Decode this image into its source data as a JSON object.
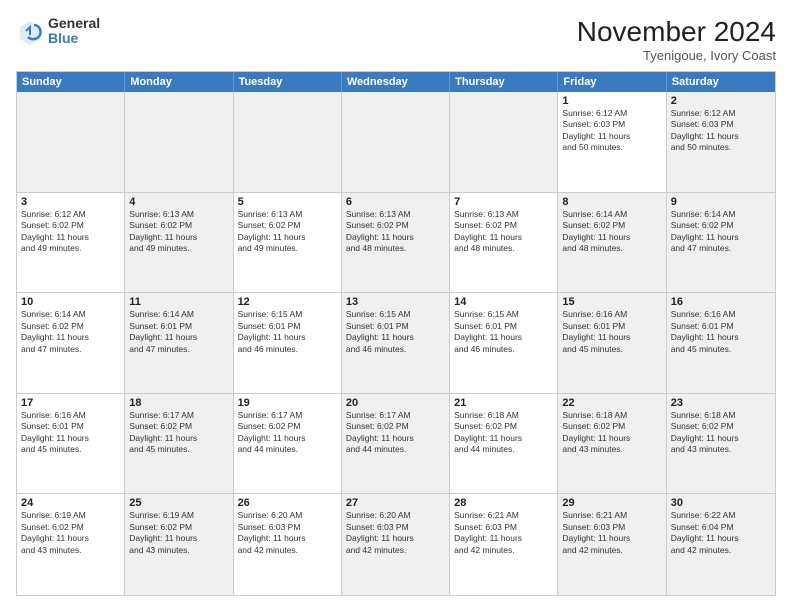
{
  "logo": {
    "general": "General",
    "blue": "Blue"
  },
  "title": "November 2024",
  "location": "Tyenigoue, Ivory Coast",
  "days_of_week": [
    "Sunday",
    "Monday",
    "Tuesday",
    "Wednesday",
    "Thursday",
    "Friday",
    "Saturday"
  ],
  "weeks": [
    [
      {
        "day": "",
        "info": "",
        "shaded": true
      },
      {
        "day": "",
        "info": "",
        "shaded": true
      },
      {
        "day": "",
        "info": "",
        "shaded": true
      },
      {
        "day": "",
        "info": "",
        "shaded": true
      },
      {
        "day": "",
        "info": "",
        "shaded": true
      },
      {
        "day": "1",
        "info": "Sunrise: 6:12 AM\nSunset: 6:03 PM\nDaylight: 11 hours\nand 50 minutes.",
        "shaded": false
      },
      {
        "day": "2",
        "info": "Sunrise: 6:12 AM\nSunset: 6:03 PM\nDaylight: 11 hours\nand 50 minutes.",
        "shaded": true
      }
    ],
    [
      {
        "day": "3",
        "info": "Sunrise: 6:12 AM\nSunset: 6:02 PM\nDaylight: 11 hours\nand 49 minutes.",
        "shaded": false
      },
      {
        "day": "4",
        "info": "Sunrise: 6:13 AM\nSunset: 6:02 PM\nDaylight: 11 hours\nand 49 minutes.",
        "shaded": true
      },
      {
        "day": "5",
        "info": "Sunrise: 6:13 AM\nSunset: 6:02 PM\nDaylight: 11 hours\nand 49 minutes.",
        "shaded": false
      },
      {
        "day": "6",
        "info": "Sunrise: 6:13 AM\nSunset: 6:02 PM\nDaylight: 11 hours\nand 48 minutes.",
        "shaded": true
      },
      {
        "day": "7",
        "info": "Sunrise: 6:13 AM\nSunset: 6:02 PM\nDaylight: 11 hours\nand 48 minutes.",
        "shaded": false
      },
      {
        "day": "8",
        "info": "Sunrise: 6:14 AM\nSunset: 6:02 PM\nDaylight: 11 hours\nand 48 minutes.",
        "shaded": true
      },
      {
        "day": "9",
        "info": "Sunrise: 6:14 AM\nSunset: 6:02 PM\nDaylight: 11 hours\nand 47 minutes.",
        "shaded": true
      }
    ],
    [
      {
        "day": "10",
        "info": "Sunrise: 6:14 AM\nSunset: 6:02 PM\nDaylight: 11 hours\nand 47 minutes.",
        "shaded": false
      },
      {
        "day": "11",
        "info": "Sunrise: 6:14 AM\nSunset: 6:01 PM\nDaylight: 11 hours\nand 47 minutes.",
        "shaded": true
      },
      {
        "day": "12",
        "info": "Sunrise: 6:15 AM\nSunset: 6:01 PM\nDaylight: 11 hours\nand 46 minutes.",
        "shaded": false
      },
      {
        "day": "13",
        "info": "Sunrise: 6:15 AM\nSunset: 6:01 PM\nDaylight: 11 hours\nand 46 minutes.",
        "shaded": true
      },
      {
        "day": "14",
        "info": "Sunrise: 6:15 AM\nSunset: 6:01 PM\nDaylight: 11 hours\nand 46 minutes.",
        "shaded": false
      },
      {
        "day": "15",
        "info": "Sunrise: 6:16 AM\nSunset: 6:01 PM\nDaylight: 11 hours\nand 45 minutes.",
        "shaded": true
      },
      {
        "day": "16",
        "info": "Sunrise: 6:16 AM\nSunset: 6:01 PM\nDaylight: 11 hours\nand 45 minutes.",
        "shaded": true
      }
    ],
    [
      {
        "day": "17",
        "info": "Sunrise: 6:16 AM\nSunset: 6:01 PM\nDaylight: 11 hours\nand 45 minutes.",
        "shaded": false
      },
      {
        "day": "18",
        "info": "Sunrise: 6:17 AM\nSunset: 6:02 PM\nDaylight: 11 hours\nand 45 minutes.",
        "shaded": true
      },
      {
        "day": "19",
        "info": "Sunrise: 6:17 AM\nSunset: 6:02 PM\nDaylight: 11 hours\nand 44 minutes.",
        "shaded": false
      },
      {
        "day": "20",
        "info": "Sunrise: 6:17 AM\nSunset: 6:02 PM\nDaylight: 11 hours\nand 44 minutes.",
        "shaded": true
      },
      {
        "day": "21",
        "info": "Sunrise: 6:18 AM\nSunset: 6:02 PM\nDaylight: 11 hours\nand 44 minutes.",
        "shaded": false
      },
      {
        "day": "22",
        "info": "Sunrise: 6:18 AM\nSunset: 6:02 PM\nDaylight: 11 hours\nand 43 minutes.",
        "shaded": true
      },
      {
        "day": "23",
        "info": "Sunrise: 6:18 AM\nSunset: 6:02 PM\nDaylight: 11 hours\nand 43 minutes.",
        "shaded": true
      }
    ],
    [
      {
        "day": "24",
        "info": "Sunrise: 6:19 AM\nSunset: 6:02 PM\nDaylight: 11 hours\nand 43 minutes.",
        "shaded": false
      },
      {
        "day": "25",
        "info": "Sunrise: 6:19 AM\nSunset: 6:02 PM\nDaylight: 11 hours\nand 43 minutes.",
        "shaded": true
      },
      {
        "day": "26",
        "info": "Sunrise: 6:20 AM\nSunset: 6:03 PM\nDaylight: 11 hours\nand 42 minutes.",
        "shaded": false
      },
      {
        "day": "27",
        "info": "Sunrise: 6:20 AM\nSunset: 6:03 PM\nDaylight: 11 hours\nand 42 minutes.",
        "shaded": true
      },
      {
        "day": "28",
        "info": "Sunrise: 6:21 AM\nSunset: 6:03 PM\nDaylight: 11 hours\nand 42 minutes.",
        "shaded": false
      },
      {
        "day": "29",
        "info": "Sunrise: 6:21 AM\nSunset: 6:03 PM\nDaylight: 11 hours\nand 42 minutes.",
        "shaded": true
      },
      {
        "day": "30",
        "info": "Sunrise: 6:22 AM\nSunset: 6:04 PM\nDaylight: 11 hours\nand 42 minutes.",
        "shaded": true
      }
    ]
  ]
}
